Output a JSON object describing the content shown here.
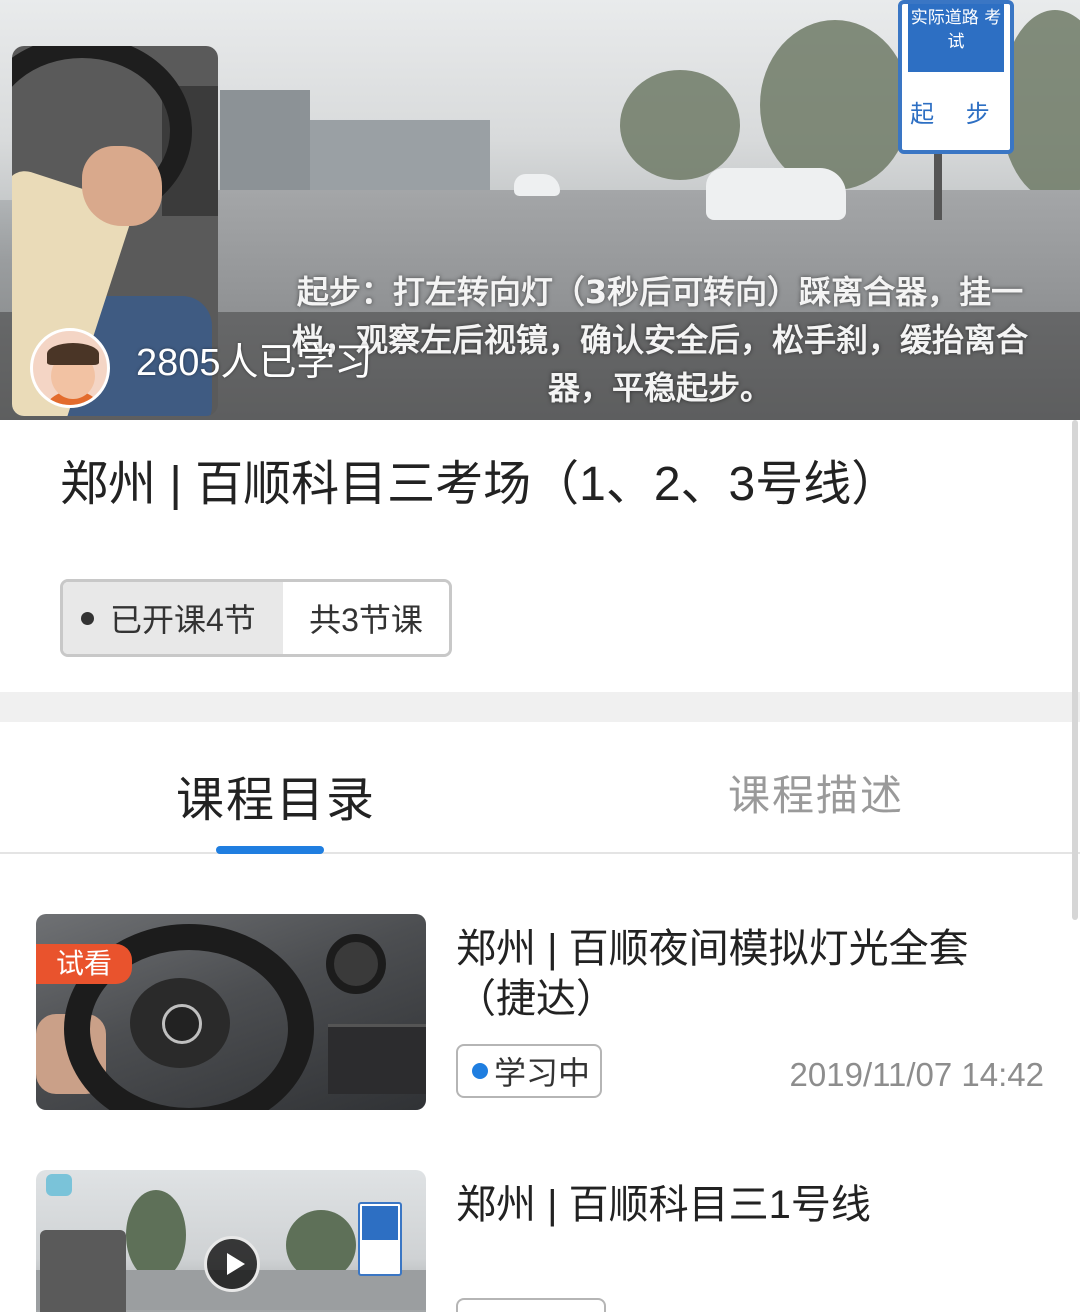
{
  "hero": {
    "caption": "起步：打左转向灯（3秒后可转向）踩离合器，挂一档，观察左后视镜，确认安全后，松手刹，缓抬离合器，平稳起步。",
    "sign_top": "实际道路 考 试",
    "sign_bottom": "起 步",
    "learner_count": "2805人已学习"
  },
  "course": {
    "title": "郑州 | 百顺科目三考场（1、2、3号线）",
    "opened_label": "已开课4节",
    "total_label": "共3节课"
  },
  "tabs": {
    "catalog": "课程目录",
    "description": "课程描述"
  },
  "lessons": [
    {
      "badge": "试看",
      "title": "郑州 | 百顺夜间模拟灯光全套（捷达）",
      "status": "学习中",
      "time": "2019/11/07 14:42"
    },
    {
      "title": "郑州 | 百顺科目三1号线"
    }
  ],
  "colors": {
    "accent": "#1f7ee0",
    "badge": "#e9532d",
    "muted_text": "#9a9a9a"
  }
}
